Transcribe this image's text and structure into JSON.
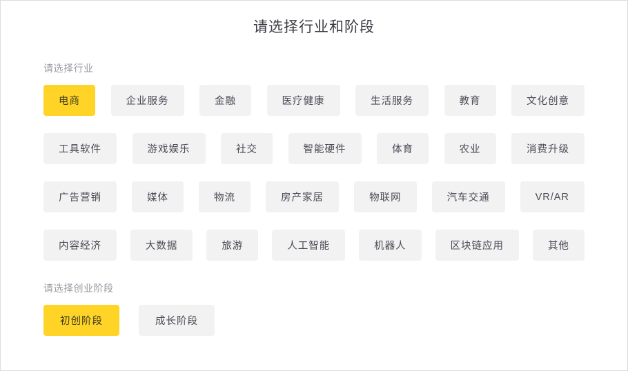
{
  "header": {
    "title": "请选择行业和阶段"
  },
  "industry": {
    "label": "请选择行业",
    "rows": [
      [
        {
          "label": "电商",
          "selected": true
        },
        {
          "label": "企业服务",
          "selected": false
        },
        {
          "label": "金融",
          "selected": false
        },
        {
          "label": "医疗健康",
          "selected": false
        },
        {
          "label": "生活服务",
          "selected": false
        },
        {
          "label": "教育",
          "selected": false
        },
        {
          "label": "文化创意",
          "selected": false
        }
      ],
      [
        {
          "label": "工具软件",
          "selected": false
        },
        {
          "label": "游戏娱乐",
          "selected": false
        },
        {
          "label": "社交",
          "selected": false
        },
        {
          "label": "智能硬件",
          "selected": false
        },
        {
          "label": "体育",
          "selected": false
        },
        {
          "label": "农业",
          "selected": false
        },
        {
          "label": "消费升级",
          "selected": false
        }
      ],
      [
        {
          "label": "广告营销",
          "selected": false
        },
        {
          "label": "媒体",
          "selected": false
        },
        {
          "label": "物流",
          "selected": false
        },
        {
          "label": "房产家居",
          "selected": false
        },
        {
          "label": "物联网",
          "selected": false
        },
        {
          "label": "汽车交通",
          "selected": false
        },
        {
          "label": "VR/AR",
          "selected": false
        }
      ],
      [
        {
          "label": "内容经济",
          "selected": false
        },
        {
          "label": "大数据",
          "selected": false
        },
        {
          "label": "旅游",
          "selected": false
        },
        {
          "label": "人工智能",
          "selected": false
        },
        {
          "label": "机器人",
          "selected": false
        },
        {
          "label": "区块链应用",
          "selected": false
        },
        {
          "label": "其他",
          "selected": false
        }
      ]
    ]
  },
  "stage": {
    "label": "请选择创业阶段",
    "options": [
      {
        "label": "初创阶段",
        "selected": true
      },
      {
        "label": "成长阶段",
        "selected": false
      }
    ]
  },
  "colors": {
    "accent": "#ffd426",
    "chip_background": "#f2f2f2",
    "chip_text": "#4a4a55",
    "label_text": "#9a9aa2",
    "title_text": "#3b3b44",
    "page_background": "#ffffff",
    "border": "#dcdcdc"
  }
}
